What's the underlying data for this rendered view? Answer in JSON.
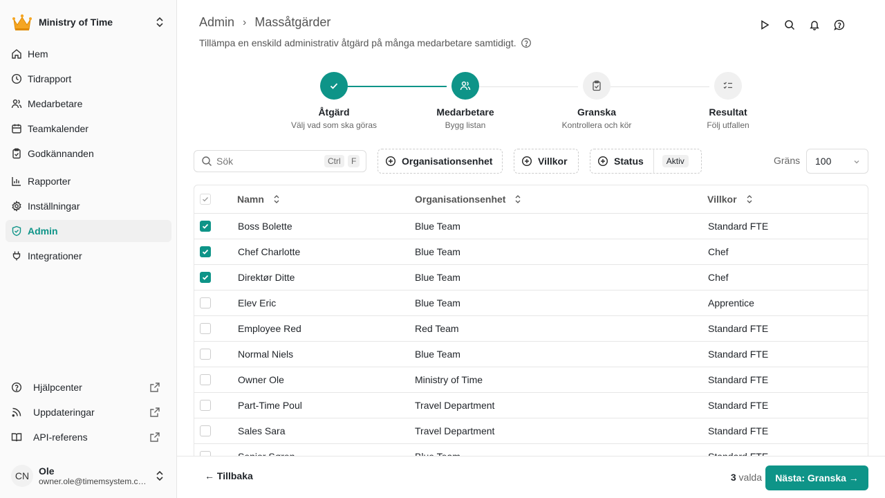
{
  "org": {
    "name": "Ministry of Time"
  },
  "nav": [
    {
      "label": "Hem",
      "icon": "home-icon"
    },
    {
      "label": "Tidrapport",
      "icon": "clock-icon"
    },
    {
      "label": "Medarbetare",
      "icon": "users-icon"
    },
    {
      "label": "Teamkalender",
      "icon": "calendar-icon"
    },
    {
      "label": "Godkännanden",
      "icon": "clipboard-check-icon"
    },
    {
      "label": "Rapporter",
      "icon": "chart-icon"
    },
    {
      "label": "Inställningar",
      "icon": "gear-icon"
    },
    {
      "label": "Admin",
      "icon": "shield-check-icon",
      "active": true
    },
    {
      "label": "Integrationer",
      "icon": "plug-icon"
    }
  ],
  "footer_nav": [
    {
      "label": "Hjälpcenter",
      "icon": "help-circle-icon"
    },
    {
      "label": "Uppdateringar",
      "icon": "rss-icon"
    },
    {
      "label": "API-referens",
      "icon": "book-icon"
    }
  ],
  "user": {
    "initials": "CN",
    "name": "Ole",
    "email": "owner.ole@timemsystem.com"
  },
  "header": {
    "breadcrumb_root": "Admin",
    "breadcrumb_current": "Massåtgärder",
    "subtitle": "Tillämpa en enskild administrativ åtgärd på många medarbetare samtidigt."
  },
  "steps": [
    {
      "title": "Åtgärd",
      "desc": "Välj vad som ska göras",
      "state": "done"
    },
    {
      "title": "Medarbetare",
      "desc": "Bygg listan",
      "state": "current"
    },
    {
      "title": "Granska",
      "desc": "Kontrollera och kör",
      "state": "todo"
    },
    {
      "title": "Resultat",
      "desc": "Följ utfallen",
      "state": "todo"
    }
  ],
  "filters": {
    "search_placeholder": "Sök",
    "kbd_ctrl": "Ctrl",
    "kbd_f": "F",
    "org_unit": "Organisationsenhet",
    "conditions": "Villkor",
    "status": "Status",
    "status_value": "Aktiv",
    "limit_label": "Gräns",
    "limit_value": "100"
  },
  "table": {
    "columns": [
      "Namn",
      "Organisationsenhet",
      "Villkor"
    ],
    "rows": [
      {
        "name": "Boss Bolette",
        "org": "Blue Team",
        "cond": "Standard FTE",
        "checked": true
      },
      {
        "name": "Chef Charlotte",
        "org": "Blue Team",
        "cond": "Chef",
        "checked": true
      },
      {
        "name": "Direktør Ditte",
        "org": "Blue Team",
        "cond": "Chef",
        "checked": true
      },
      {
        "name": "Elev Eric",
        "org": "Blue Team",
        "cond": "Apprentice",
        "checked": false
      },
      {
        "name": "Employee Red",
        "org": "Red Team",
        "cond": "Standard FTE",
        "checked": false
      },
      {
        "name": "Normal Niels",
        "org": "Blue Team",
        "cond": "Standard FTE",
        "checked": false
      },
      {
        "name": "Owner Ole",
        "org": "Ministry of Time",
        "cond": "Standard FTE",
        "checked": false
      },
      {
        "name": "Part-Time Poul",
        "org": "Travel Department",
        "cond": "Standard FTE",
        "checked": false
      },
      {
        "name": "Sales Sara",
        "org": "Travel Department",
        "cond": "Standard FTE",
        "checked": false
      },
      {
        "name": "Senior Søren",
        "org": "Blue Team",
        "cond": "Standard FTE",
        "checked": false
      }
    ]
  },
  "footer": {
    "back_label": "← Tillbaka",
    "selected_count": "3",
    "selected_label": "valda",
    "next_label": "Nästa: Granska →"
  },
  "colors": {
    "accent": "#0e9488",
    "border": "#e6e6e6"
  }
}
